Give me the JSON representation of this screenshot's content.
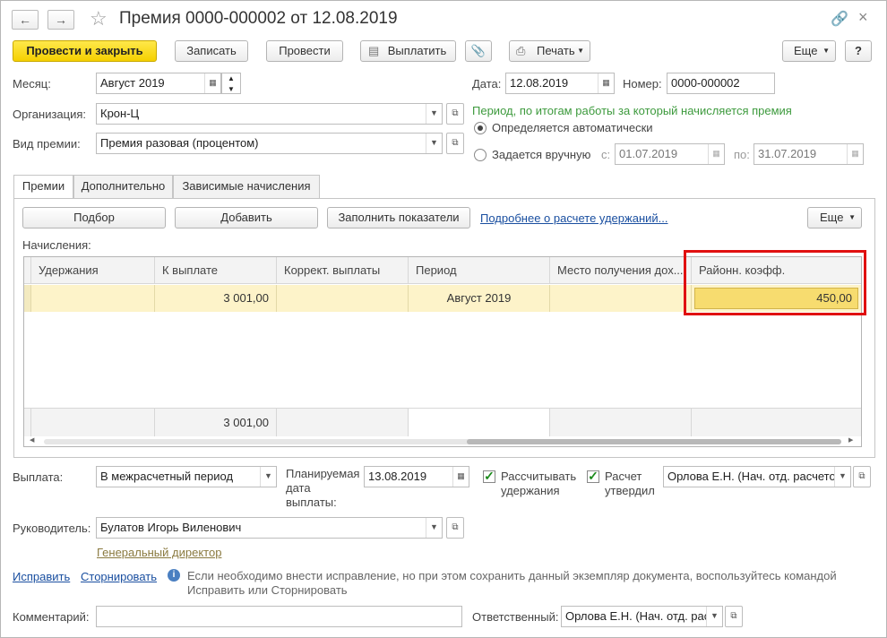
{
  "window": {
    "title": "Премия 0000-000002 от 12.08.2019"
  },
  "toolbar": {
    "post_close": "Провести и закрыть",
    "save": "Записать",
    "post": "Провести",
    "pay": "Выплатить",
    "print": "Печать",
    "more": "Еще",
    "help": "?"
  },
  "header": {
    "month_label": "Месяц:",
    "month_value": "Август 2019",
    "org_label": "Организация:",
    "org_value": "Крон-Ц",
    "bonus_type_label": "Вид премии:",
    "bonus_type_value": "Премия разовая (процентом)",
    "date_label": "Дата:",
    "date_value": "12.08.2019",
    "number_label": "Номер:",
    "number_value": "0000-000002",
    "period_note": "Период, по итогам работы за который начисляется премия",
    "radio_auto": "Определяется автоматически",
    "radio_manual": "Задается вручную",
    "from_label": "с:",
    "from_value": "01.07.2019",
    "to_label": "по:",
    "to_value": "31.07.2019"
  },
  "tabs": [
    {
      "label": "Премии"
    },
    {
      "label": "Дополнительно"
    },
    {
      "label": "Зависимые начисления"
    }
  ],
  "panel": {
    "pick": "Подбор",
    "add": "Добавить",
    "fill": "Заполнить показатели",
    "details_link": "Подробнее о расчете удержаний...",
    "more": "Еще",
    "accruals_label": "Начисления:"
  },
  "table": {
    "columns": [
      "Удержания",
      "К выплате",
      "Коррект. выплаты",
      "Период",
      "Место получения дох...",
      "Районн. коэфф."
    ],
    "rows": [
      {
        "deductions": "",
        "to_pay": "3 001,00",
        "correction": "",
        "period": "Август 2019",
        "place": "",
        "coef": "450,00"
      }
    ],
    "footer": {
      "to_pay_total": "3 001,00"
    }
  },
  "payment": {
    "payment_label": "Выплата:",
    "payment_value": "В межрасчетный период",
    "planned_label_1": "Планируемая",
    "planned_label_2": "дата",
    "planned_label_3": "выплаты:",
    "planned_value": "13.08.2019",
    "calc_deductions_1": "Рассчитывать",
    "calc_deductions_2": "удержания",
    "approved_1": "Расчет",
    "approved_2": "утвердил",
    "approver_value": "Орлова Е.Н. (Нач. отд. расчетов"
  },
  "manager": {
    "label": "Руководитель:",
    "value": "Булатов Игорь Виленович",
    "position": "Генеральный директор"
  },
  "correction": {
    "fix_link": "Исправить",
    "reverse_link": "Сторнировать",
    "info_line1": "Если необходимо внести исправление, но при этом сохранить данный экземпляр документа, воспользуйтесь командой",
    "info_line2": "Исправить или Сторнировать"
  },
  "bottom": {
    "comment_label": "Комментарий:",
    "comment_value": "",
    "responsible_label": "Ответственный:",
    "responsible_value": "Орлова Е.Н. (Нач. отд. расч"
  },
  "colors": {
    "accent_yellow": "#f5d000",
    "selected_row": "#fdf3c9",
    "highlight_cell": "#f7dc6f",
    "red_frame": "#e01010",
    "link_blue": "#1a4fa0",
    "note_green": "#3d9a3d"
  }
}
